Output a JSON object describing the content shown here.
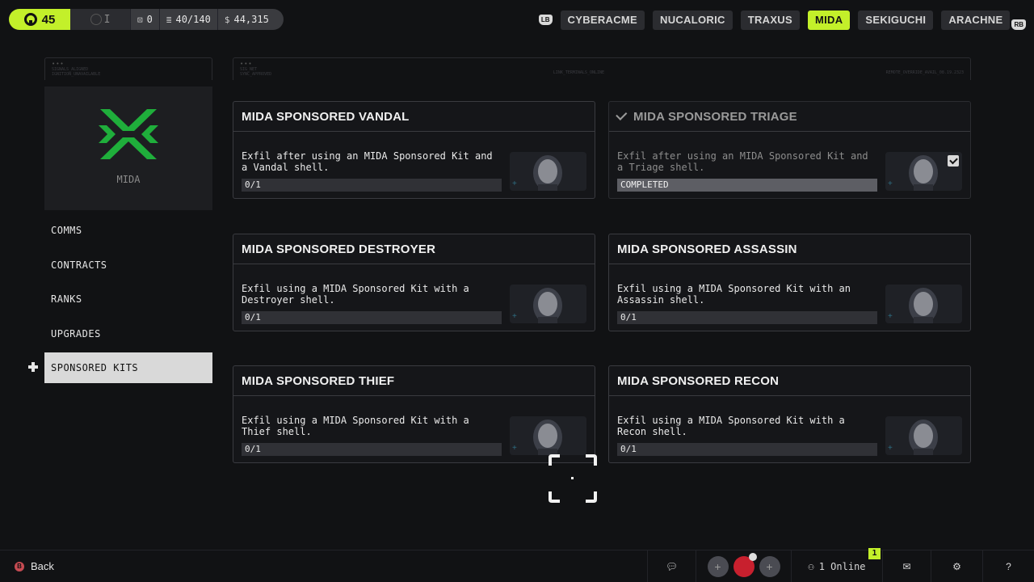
{
  "player": {
    "level": "45",
    "rank_label": "I",
    "item_count": "0",
    "capacity": "40/140",
    "credits": "44,315"
  },
  "factions": {
    "hint_left": "LB",
    "hint_right": "RB",
    "tabs": [
      {
        "label": "CYBERACME"
      },
      {
        "label": "NUCALORIC"
      },
      {
        "label": "TRAXUS"
      },
      {
        "label": "MIDA"
      },
      {
        "label": "SEKIGUCHI"
      },
      {
        "label": "ARACHNE"
      }
    ],
    "active": "MIDA"
  },
  "header_strip": {
    "left_dots": "•••",
    "left_text": "SIGNALS_ALIGNED\nIGNITION_UNAVAILABLE",
    "right_dots": "•••",
    "right_text_1": "SIG_NET\nSYNC_APPROVED",
    "right_text_2": "LINK_TERMINALS_ONLINE",
    "right_text_3": "REMOTE_OVERRIDE_AVAIL_08.19.2323"
  },
  "faction_panel": {
    "name": "MIDA",
    "logo_color": "#1fae3b"
  },
  "nav": {
    "items": [
      {
        "label": "COMMS"
      },
      {
        "label": "CONTRACTS"
      },
      {
        "label": "RANKS"
      },
      {
        "label": "UPGRADES"
      },
      {
        "label": "SPONSORED KITS"
      }
    ],
    "active_index": 4
  },
  "contracts": [
    {
      "title": "MIDA SPONSORED VANDAL",
      "description": "Exfil after using an MIDA Sponsored Kit and a Vandal shell.",
      "progress": "0/1",
      "progress_fraction": 0,
      "completed": false
    },
    {
      "title": "MIDA SPONSORED TRIAGE",
      "description": "Exfil after using an MIDA Sponsored Kit and a Triage shell.",
      "progress": "COMPLETED",
      "progress_fraction": 1,
      "completed": true
    },
    {
      "title": "MIDA SPONSORED DESTROYER",
      "description": "Exfil using a MIDA Sponsored Kit with a Destroyer shell.",
      "progress": "0/1",
      "progress_fraction": 0,
      "completed": false
    },
    {
      "title": "MIDA SPONSORED ASSASSIN",
      "description": "Exfil using a MIDA Sponsored Kit with an Assassin shell.",
      "progress": "0/1",
      "progress_fraction": 0,
      "completed": false
    },
    {
      "title": "MIDA SPONSORED THIEF",
      "description": "Exfil using a MIDA Sponsored Kit with a Thief shell.",
      "progress": "0/1",
      "progress_fraction": 0,
      "completed": false
    },
    {
      "title": "MIDA SPONSORED RECON",
      "description": "Exfil using a MIDA Sponsored Kit with a Recon shell.",
      "progress": "0/1",
      "progress_fraction": 0,
      "completed": false
    }
  ],
  "bottom": {
    "back_hint": "B",
    "back_label": "Back",
    "online_label": "1 Online",
    "notification_count": "1"
  },
  "colors": {
    "accent": "#c3f02a",
    "panel": "#1d1e21",
    "card_border": "#3a3b40",
    "party_self": "#c8202e"
  }
}
